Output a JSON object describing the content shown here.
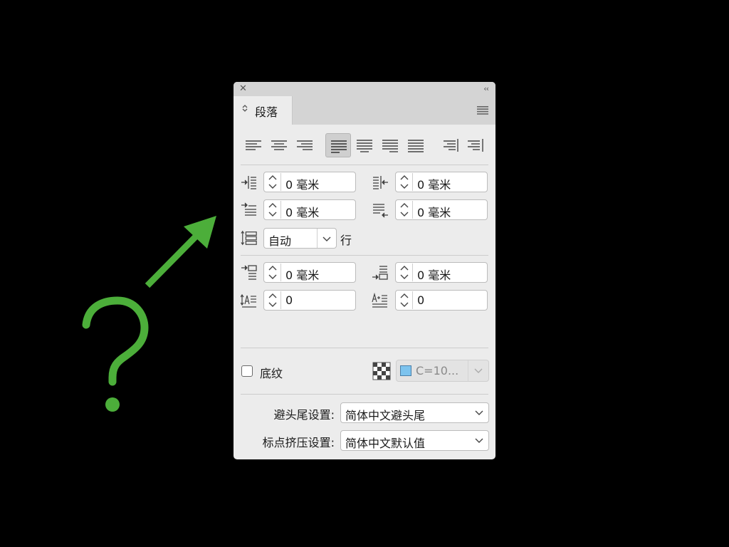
{
  "annotation": {
    "question_mark": "?",
    "arrow_color": "#4cae3a"
  },
  "panel": {
    "close_glyph": "✕",
    "collapse_glyph": "‹‹",
    "tab_title": "段落",
    "tab_chevron": "⌃⌄",
    "alignment_buttons": [
      "align-left",
      "align-center",
      "align-right",
      "justify-last-left",
      "justify-last-center",
      "justify-last-right",
      "justify-all",
      "align-towards-spine",
      "align-away-from-spine"
    ],
    "active_alignment": "justify-last-left",
    "left_indent": "0 毫米",
    "right_indent": "0 毫米",
    "first_line_indent": "0 毫米",
    "last_line_right_indent": "0 毫米",
    "line_mode": "自动",
    "line_unit": "行",
    "space_before": "0 毫米",
    "space_after": "0 毫米",
    "dropcap_lines": "0",
    "dropcap_chars": "0",
    "shading_label": "底纹",
    "shading_color": "C=10...",
    "shading_swatch_color": "#7cc3ee",
    "kinsoku_label": "避头尾设置:",
    "kinsoku_value": "简体中文避头尾",
    "mojikumi_label": "标点挤压设置:",
    "mojikumi_value": "简体中文默认值"
  }
}
